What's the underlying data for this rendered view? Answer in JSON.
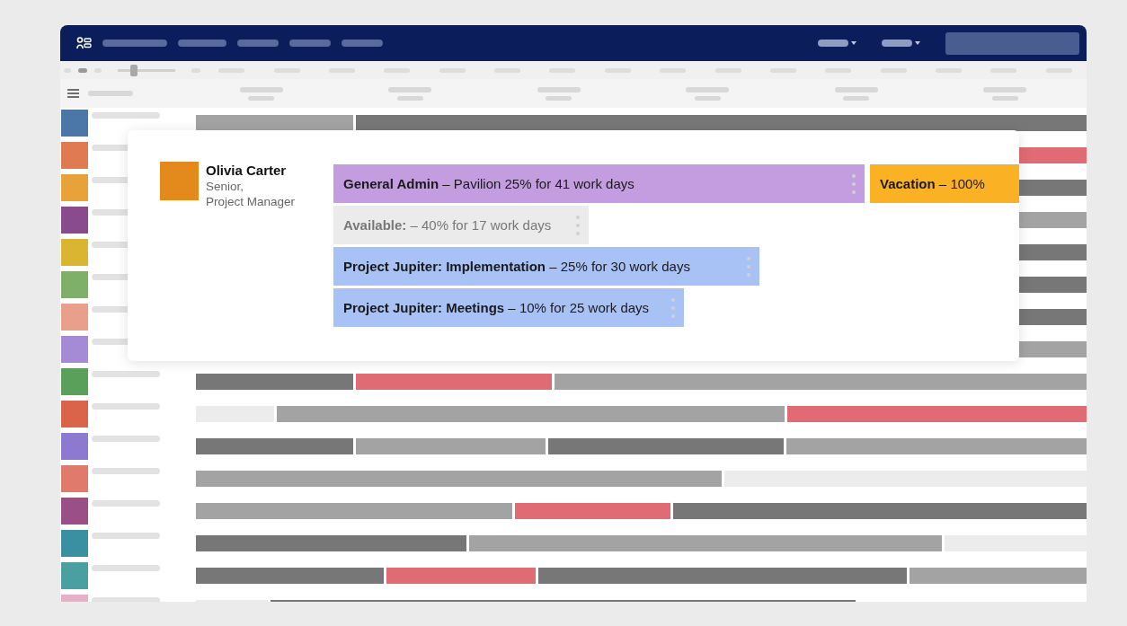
{
  "zoom_slider": {
    "level": 0.25
  },
  "profile": {
    "name": "Olivia Carter",
    "role_lines": [
      "Senior,",
      "Project Manager"
    ]
  },
  "assignment_rows": [
    {
      "items": [
        {
          "kind": "admin",
          "text": "**General Admin** – Pavilion 25% for 41 work days",
          "color": "#c39ddf"
        },
        {
          "kind": "vacation",
          "text": "**Vacation** – 100%",
          "color": "#fbb124"
        }
      ]
    },
    {
      "items": [
        {
          "kind": "available",
          "text": "**Available:** – 40% for 17 work days",
          "color": "#ebebeb"
        }
      ]
    },
    {
      "items": [
        {
          "kind": "project",
          "text": "**Project Jupiter: Implementation** – 25% for 30 work days",
          "color": "#a9c2f6"
        }
      ]
    },
    {
      "items": [
        {
          "kind": "project",
          "text": "**Project Jupiter: Meetings** – 10% for 25 work days",
          "color": "#a9c2f6"
        }
      ]
    }
  ]
}
